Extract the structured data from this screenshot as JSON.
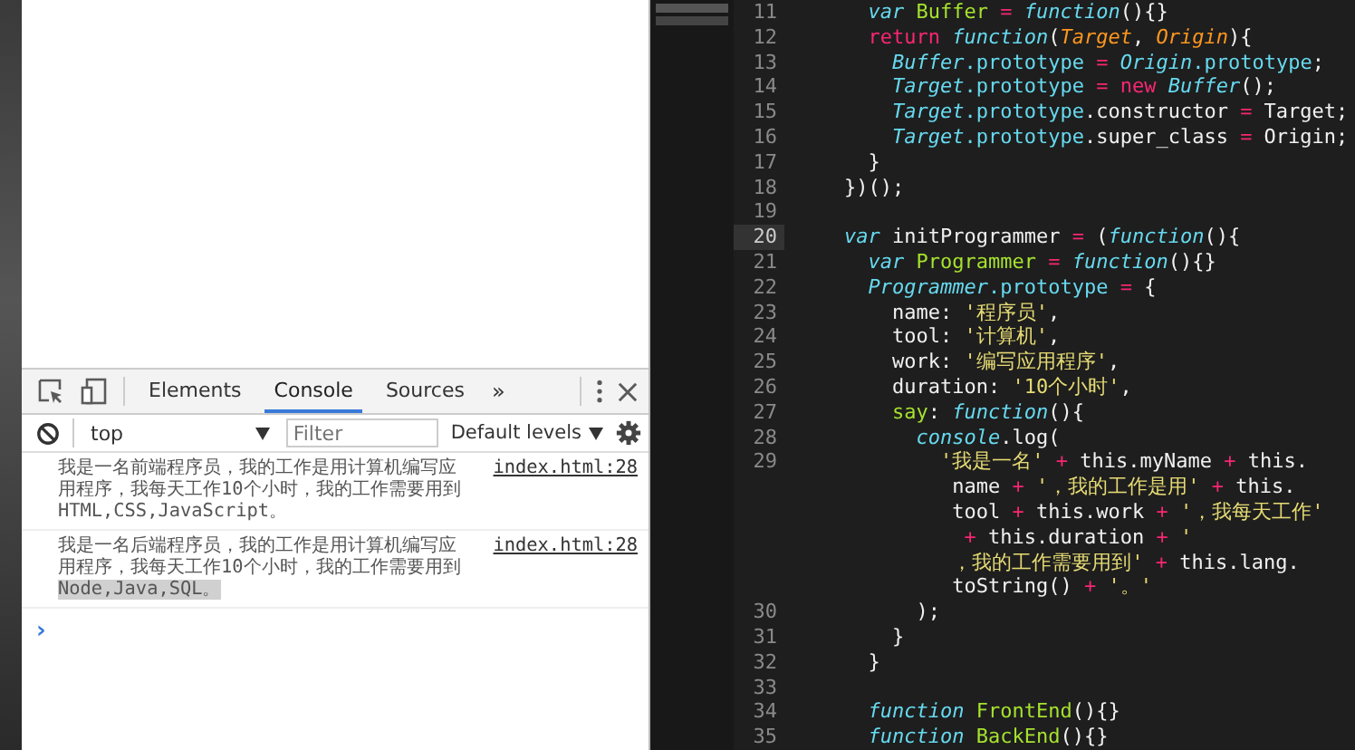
{
  "devtools": {
    "tabs": [
      {
        "label": "Elements",
        "selected": false
      },
      {
        "label": "Console",
        "selected": true
      },
      {
        "label": "Sources",
        "selected": false
      }
    ],
    "more_tabs": "»",
    "context": "top",
    "filter": {
      "placeholder": "Filter"
    },
    "levels": "Default levels",
    "messages": [
      {
        "text": "我是一名前端程序员，我的工作是用计算机编写应用程序，我每天工作10个小时，我的工作需要用到HTML,CSS,JavaScript。",
        "source": "index.html:28"
      },
      {
        "text": "我是一名后端程序员，我的工作是用计算机编写应用程序，我每天工作10个小时，我的工作需要用到",
        "selected_text": "Node,Java,SQL。",
        "source": "index.html:28"
      }
    ],
    "prompt": "›"
  },
  "editor": {
    "lines": [
      {
        "number": "11",
        "current": false,
        "tokens": [
          {
            "kind": "kw",
            "text": "  var "
          },
          {
            "kind": "fn",
            "text": "Buffer"
          },
          {
            "kind": "op",
            "text": " = "
          },
          {
            "kind": "kw",
            "text": "function"
          },
          {
            "kind": "plain",
            "text": "(){}"
          }
        ]
      },
      {
        "number": "12",
        "current": false,
        "tokens": [
          {
            "kind": "op",
            "text": "  return "
          },
          {
            "kind": "kw",
            "text": "function"
          },
          {
            "kind": "plain",
            "text": "("
          },
          {
            "kind": "param",
            "text": "Target"
          },
          {
            "kind": "plain",
            "text": ", "
          },
          {
            "kind": "param",
            "text": "Origin"
          },
          {
            "kind": "plain",
            "text": "){"
          }
        ]
      },
      {
        "number": "13",
        "current": false,
        "tokens": [
          {
            "kind": "cls",
            "text": "    Buffer"
          },
          {
            "kind": "cls2",
            "text": ".prototype"
          },
          {
            "kind": "op",
            "text": " = "
          },
          {
            "kind": "cls",
            "text": "Origin"
          },
          {
            "kind": "cls2",
            "text": ".prototype"
          },
          {
            "kind": "plain",
            "text": ";"
          }
        ]
      },
      {
        "number": "14",
        "current": false,
        "tokens": [
          {
            "kind": "cls",
            "text": "    Target"
          },
          {
            "kind": "cls2",
            "text": ".prototype"
          },
          {
            "kind": "op",
            "text": " = new "
          },
          {
            "kind": "cls",
            "text": "Buffer"
          },
          {
            "kind": "plain",
            "text": "();"
          }
        ]
      },
      {
        "number": "15",
        "current": false,
        "tokens": [
          {
            "kind": "cls",
            "text": "    Target"
          },
          {
            "kind": "cls2",
            "text": ".prototype"
          },
          {
            "kind": "plain",
            "text": ".constructor "
          },
          {
            "kind": "op",
            "text": "="
          },
          {
            "kind": "plain",
            "text": " Target;"
          }
        ]
      },
      {
        "number": "16",
        "current": false,
        "tokens": [
          {
            "kind": "cls",
            "text": "    Target"
          },
          {
            "kind": "cls2",
            "text": ".prototype"
          },
          {
            "kind": "plain",
            "text": ".super_class "
          },
          {
            "kind": "op",
            "text": "="
          },
          {
            "kind": "plain",
            "text": " Origin;"
          }
        ]
      },
      {
        "number": "17",
        "current": false,
        "tokens": [
          {
            "kind": "plain",
            "text": "  }"
          }
        ]
      },
      {
        "number": "18",
        "current": false,
        "tokens": [
          {
            "kind": "plain",
            "text": "})();"
          }
        ]
      },
      {
        "number": "19",
        "current": false
      },
      {
        "number": "20",
        "current": true,
        "tokens": [
          {
            "kind": "kw",
            "text": "var "
          },
          {
            "kind": "plain",
            "text": "initProgrammer "
          },
          {
            "kind": "op",
            "text": "="
          },
          {
            "kind": "plain",
            "text": " ("
          },
          {
            "kind": "kw",
            "text": "function"
          },
          {
            "kind": "plain",
            "text": "(){"
          }
        ]
      },
      {
        "number": "21",
        "current": false,
        "tokens": [
          {
            "kind": "kw",
            "text": "  var "
          },
          {
            "kind": "fn",
            "text": "Programmer"
          },
          {
            "kind": "op",
            "text": " = "
          },
          {
            "kind": "kw",
            "text": "function"
          },
          {
            "kind": "plain",
            "text": "(){}"
          }
        ]
      },
      {
        "number": "22",
        "current": false,
        "tokens": [
          {
            "kind": "cls",
            "text": "  Programmer"
          },
          {
            "kind": "cls2",
            "text": ".prototype"
          },
          {
            "kind": "op",
            "text": " = "
          },
          {
            "kind": "plain",
            "text": "{"
          }
        ]
      },
      {
        "number": "23",
        "current": false,
        "tokens": [
          {
            "kind": "plain",
            "text": "    name: "
          },
          {
            "kind": "str",
            "text": "'程序员'"
          },
          {
            "kind": "plain",
            "text": ","
          }
        ]
      },
      {
        "number": "24",
        "current": false,
        "tokens": [
          {
            "kind": "plain",
            "text": "    tool: "
          },
          {
            "kind": "str",
            "text": "'计算机'"
          },
          {
            "kind": "plain",
            "text": ","
          }
        ]
      },
      {
        "number": "25",
        "current": false,
        "tokens": [
          {
            "kind": "plain",
            "text": "    work: "
          },
          {
            "kind": "str",
            "text": "'编写应用程序'"
          },
          {
            "kind": "plain",
            "text": ","
          }
        ]
      },
      {
        "number": "26",
        "current": false,
        "tokens": [
          {
            "kind": "plain",
            "text": "    duration: "
          },
          {
            "kind": "str",
            "text": "'10个小时'"
          },
          {
            "kind": "plain",
            "text": ","
          }
        ]
      },
      {
        "number": "27",
        "current": false,
        "tokens": [
          {
            "kind": "fn",
            "text": "    say"
          },
          {
            "kind": "plain",
            "text": ": "
          },
          {
            "kind": "kw",
            "text": "function"
          },
          {
            "kind": "plain",
            "text": "(){"
          }
        ]
      },
      {
        "number": "28",
        "current": false,
        "tokens": [
          {
            "kind": "cls",
            "text": "      console"
          },
          {
            "kind": "plain",
            "text": ".log("
          }
        ]
      },
      {
        "number": "29",
        "current": false,
        "tokens": [
          {
            "kind": "str",
            "text": "        '我是一名'"
          },
          {
            "kind": "op",
            "text": " + "
          },
          {
            "kind": "plain",
            "text": "this.myName "
          },
          {
            "kind": "op",
            "text": "+"
          },
          {
            "kind": "plain",
            "text": " this."
          }
        ]
      },
      {
        "tokens": [
          {
            "kind": "plain",
            "text": "         name "
          },
          {
            "kind": "op",
            "text": "+"
          },
          {
            "kind": "str",
            "text": " '，我的工作是用'"
          },
          {
            "kind": "op",
            "text": " + "
          },
          {
            "kind": "plain",
            "text": "this."
          }
        ]
      },
      {
        "tokens": [
          {
            "kind": "plain",
            "text": "         tool "
          },
          {
            "kind": "op",
            "text": "+"
          },
          {
            "kind": "plain",
            "text": " this.work "
          },
          {
            "kind": "op",
            "text": "+"
          },
          {
            "kind": "str",
            "text": " '，我每天工作'"
          }
        ]
      },
      {
        "tokens": [
          {
            "kind": "op",
            "text": "          + "
          },
          {
            "kind": "plain",
            "text": "this.duration "
          },
          {
            "kind": "op",
            "text": "+"
          },
          {
            "kind": "str",
            "text": " '"
          }
        ]
      },
      {
        "tokens": [
          {
            "kind": "str",
            "text": "         ，我的工作需要用到'"
          },
          {
            "kind": "op",
            "text": " + "
          },
          {
            "kind": "plain",
            "text": "this.lang."
          }
        ]
      },
      {
        "tokens": [
          {
            "kind": "plain",
            "text": "         toString() "
          },
          {
            "kind": "op",
            "text": "+"
          },
          {
            "kind": "str",
            "text": " '。'"
          }
        ]
      },
      {
        "number": "30",
        "current": false,
        "tokens": [
          {
            "kind": "plain",
            "text": "      );"
          }
        ]
      },
      {
        "number": "31",
        "current": false,
        "tokens": [
          {
            "kind": "plain",
            "text": "    }"
          }
        ]
      },
      {
        "number": "32",
        "current": false,
        "tokens": [
          {
            "kind": "plain",
            "text": "  }"
          }
        ]
      },
      {
        "number": "33",
        "current": false
      },
      {
        "number": "34",
        "current": false,
        "tokens": [
          {
            "kind": "kw",
            "text": "  function "
          },
          {
            "kind": "fn",
            "text": "FrontEnd"
          },
          {
            "kind": "plain",
            "text": "(){}"
          }
        ]
      },
      {
        "number": "35",
        "current": false,
        "tokens": [
          {
            "kind": "kw",
            "text": "  function "
          },
          {
            "kind": "fn",
            "text": "BackEnd"
          },
          {
            "kind": "plain",
            "text": "(){}"
          }
        ]
      }
    ]
  }
}
